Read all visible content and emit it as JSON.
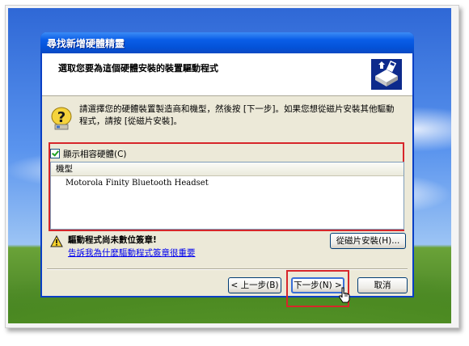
{
  "window": {
    "title": "尋找新增硬體精靈"
  },
  "header": {
    "title": "選取您要為這個硬體安裝的裝置驅動程式",
    "icon": "hardware-wizard-icon"
  },
  "instructions": {
    "icon": "help-question-icon",
    "text": "請選擇您的硬體裝置製造商和機型，然後按 [下一步]。如果您想從磁片安裝其他驅動程式，請按 [從磁片安裝]。"
  },
  "compatible": {
    "checkbox_label": "顯示相容硬體(C)",
    "checked": true
  },
  "model_list": {
    "header": "機型",
    "items": [
      "Motorola Finity Bluetooth Headset"
    ]
  },
  "warning": {
    "icon": "warning-icon",
    "text": "驅動程式尚未數位簽章!",
    "link": "告訴我為什麼驅動程式簽章很重要"
  },
  "buttons": {
    "have_disk": "從磁片安裝(H)...",
    "back": "< 上一步(B)",
    "next": "下一步(N) >",
    "cancel": "取消"
  },
  "colors": {
    "highlight_box": "#d7262a",
    "title_bar": "#0a5ee8",
    "dialog_bg": "#ece9d8",
    "link": "#0000ee"
  }
}
